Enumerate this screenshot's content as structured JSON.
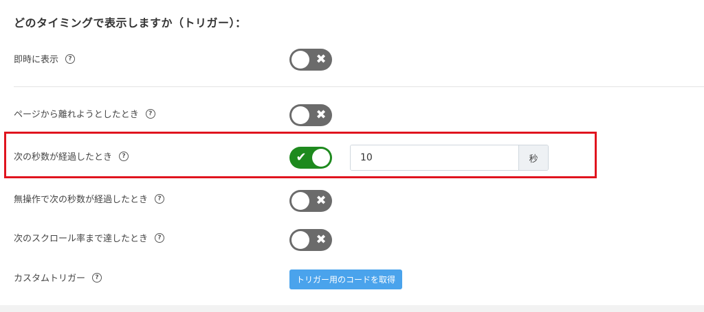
{
  "title": "どのタイミングで表示しますか（トリガー）：",
  "help_glyph": "?",
  "rows": [
    {
      "label": "即時に表示",
      "enabled": false
    },
    {
      "label": "ページから離れようとしたとき",
      "enabled": false
    },
    {
      "label": "次の秒数が経過したとき",
      "enabled": true
    },
    {
      "label": "無操作で次の秒数が経過したとき",
      "enabled": false
    },
    {
      "label": "次のスクロール率まで達したとき",
      "enabled": false
    },
    {
      "label": "カスタムトリガー"
    }
  ],
  "toggle_marks": {
    "off": "✖",
    "on": "✔"
  },
  "seconds_input": {
    "value": "10",
    "unit": "秒"
  },
  "custom_trigger_button": "トリガー用のコードを取得",
  "colors": {
    "toggle_on": "#1e8a1e",
    "toggle_off": "#6b6b6b",
    "highlight": "#e0141e",
    "button": "#4aa3ec"
  }
}
